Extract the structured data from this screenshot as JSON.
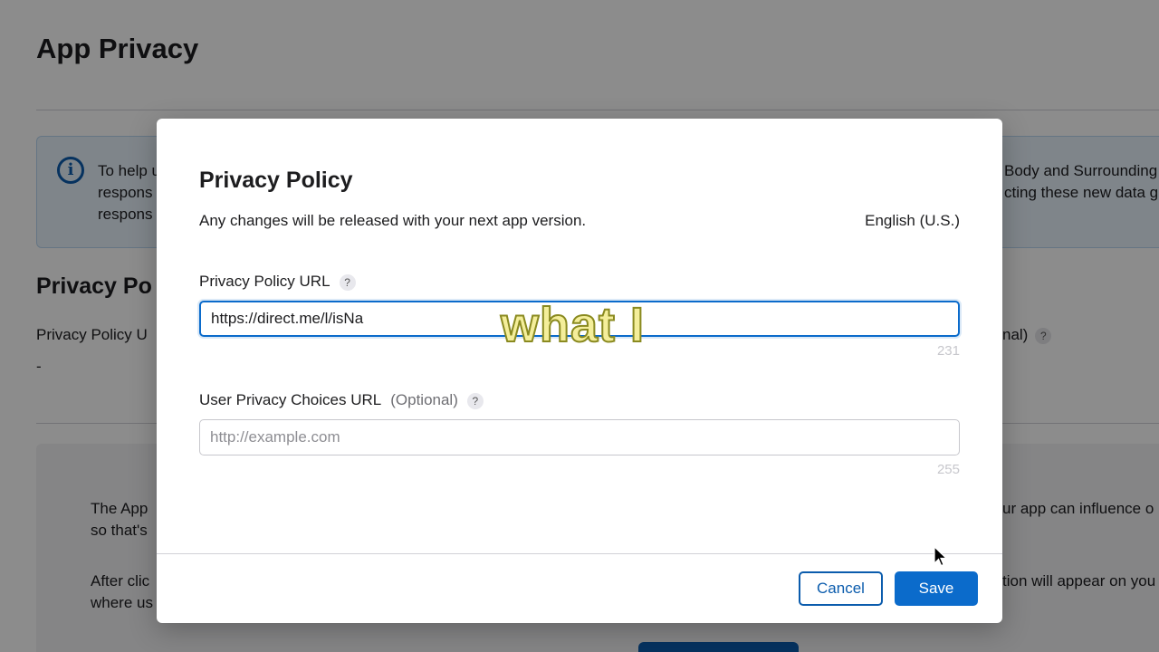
{
  "background": {
    "title": "App Privacy",
    "info_lines": [
      {
        "left": "To help u",
        "right": "Body and Surrounding"
      },
      {
        "left": "respons",
        "right": "cting these new data g"
      },
      {
        "left": "respons",
        "right": ""
      }
    ],
    "section_title": "Privacy Po",
    "privacy_policy_label": "Privacy Policy U",
    "privacy_policy_value": "-",
    "optional_fragment": "nal)",
    "para1_left": [
      "The App",
      "so that's"
    ],
    "para1_right": "ur app can influence o",
    "para2_left": [
      "After clic",
      "where us"
    ],
    "para2_right": "tion will appear on you",
    "q_mark": "?"
  },
  "modal": {
    "title": "Privacy Policy",
    "subtitle": "Any changes will be released with your next app version.",
    "language": "English (U.S.)",
    "privacy_url": {
      "label": "Privacy Policy URL",
      "help": "?",
      "value": "https://direct.me/l/isNa",
      "counter": "231"
    },
    "choices_url": {
      "label": "User Privacy Choices URL",
      "optional": "(Optional)",
      "help": "?",
      "placeholder": "http://example.com",
      "value": "",
      "counter": "255"
    },
    "cancel_label": "Cancel",
    "save_label": "Save"
  },
  "caption": "what I",
  "colors": {
    "accent": "#0b6bcb",
    "info_bg": "#e8f2fb"
  }
}
